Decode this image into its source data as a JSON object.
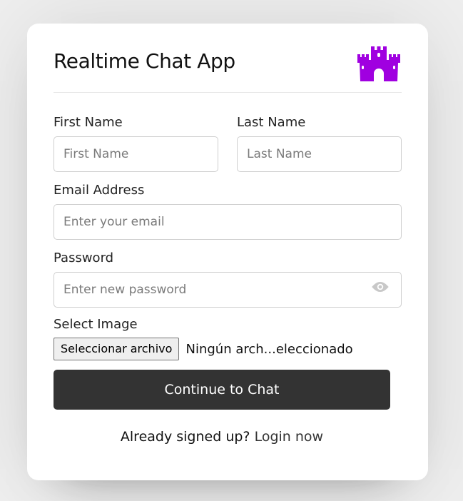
{
  "header": {
    "title": "Realtime Chat App",
    "logo_icon": "castle-icon",
    "logo_color": "#a000e0"
  },
  "form": {
    "first_name": {
      "label": "First Name",
      "placeholder": "First Name",
      "value": ""
    },
    "last_name": {
      "label": "Last Name",
      "placeholder": "Last Name",
      "value": ""
    },
    "email": {
      "label": "Email Address",
      "placeholder": "Enter your email",
      "value": ""
    },
    "password": {
      "label": "Password",
      "placeholder": "Enter new password",
      "value": "",
      "toggle_icon": "eye-icon"
    },
    "image": {
      "label": "Select Image",
      "button_label": "Seleccionar archivo",
      "status": "Ningún arch...eleccionado"
    },
    "submit_label": "Continue to Chat"
  },
  "footer": {
    "text": "Already signed up?",
    "link_text": "Login now"
  },
  "colors": {
    "background": "#efefef",
    "card": "#ffffff",
    "button": "#333333",
    "accent": "#a000e0"
  }
}
